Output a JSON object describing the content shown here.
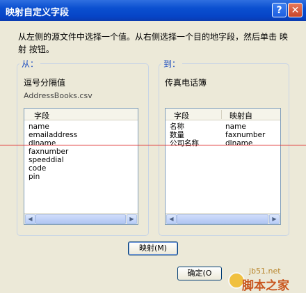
{
  "window": {
    "title": "映射自定义字段"
  },
  "instruction": "从左侧的源文件中选择一个值。从右侧选择一个目的地字段，然后单击 映射 按钮。",
  "left_group": {
    "title": "从：",
    "subtitle": "逗号分隔值",
    "filename": "AddressBooks.csv",
    "column_header": "字段",
    "items": [
      "name",
      "emailaddress",
      "dlname",
      "faxnumber",
      "speeddial",
      "code",
      "pin"
    ]
  },
  "right_group": {
    "title": "到：",
    "subtitle": "传真电话簿",
    "columns": [
      "字段",
      "映射自"
    ],
    "rows": [
      {
        "field": "名称",
        "mapped": "name"
      },
      {
        "field": "数量",
        "mapped": "faxnumber"
      },
      {
        "field": "公司名称",
        "mapped": "dlname"
      }
    ]
  },
  "buttons": {
    "help": "?",
    "close": "✕",
    "map": "映射(M)",
    "ok": "确定(O"
  },
  "watermark": {
    "line1": "jb51.net",
    "line2": "脚本之家"
  },
  "colors": {
    "title_bar": "#0a4fd0",
    "group_title": "#1f4fc0",
    "annotation_line": "#e03030"
  }
}
